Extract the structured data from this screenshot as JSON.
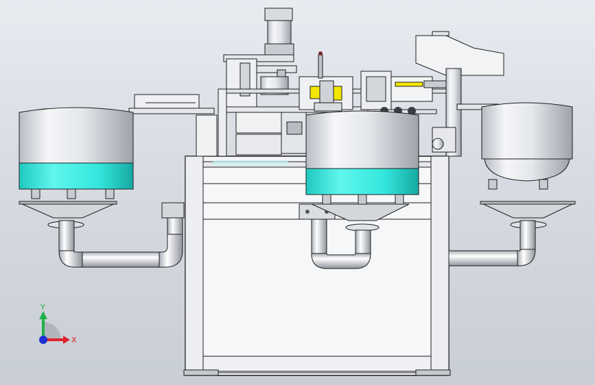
{
  "viewport": {
    "background_top": "#e8ebf0",
    "background_bottom": "#c9ced6"
  },
  "colors": {
    "bowl_band": "#33e6dc",
    "frame": "#f4f5f7",
    "outline": "#1d1d1d",
    "metal": "#d9dde3"
  },
  "triad": {
    "x_label": "X",
    "y_label": "Y",
    "x_color": "#e0202a",
    "y_color": "#22b04a",
    "z_color": "#1f2fd6"
  }
}
